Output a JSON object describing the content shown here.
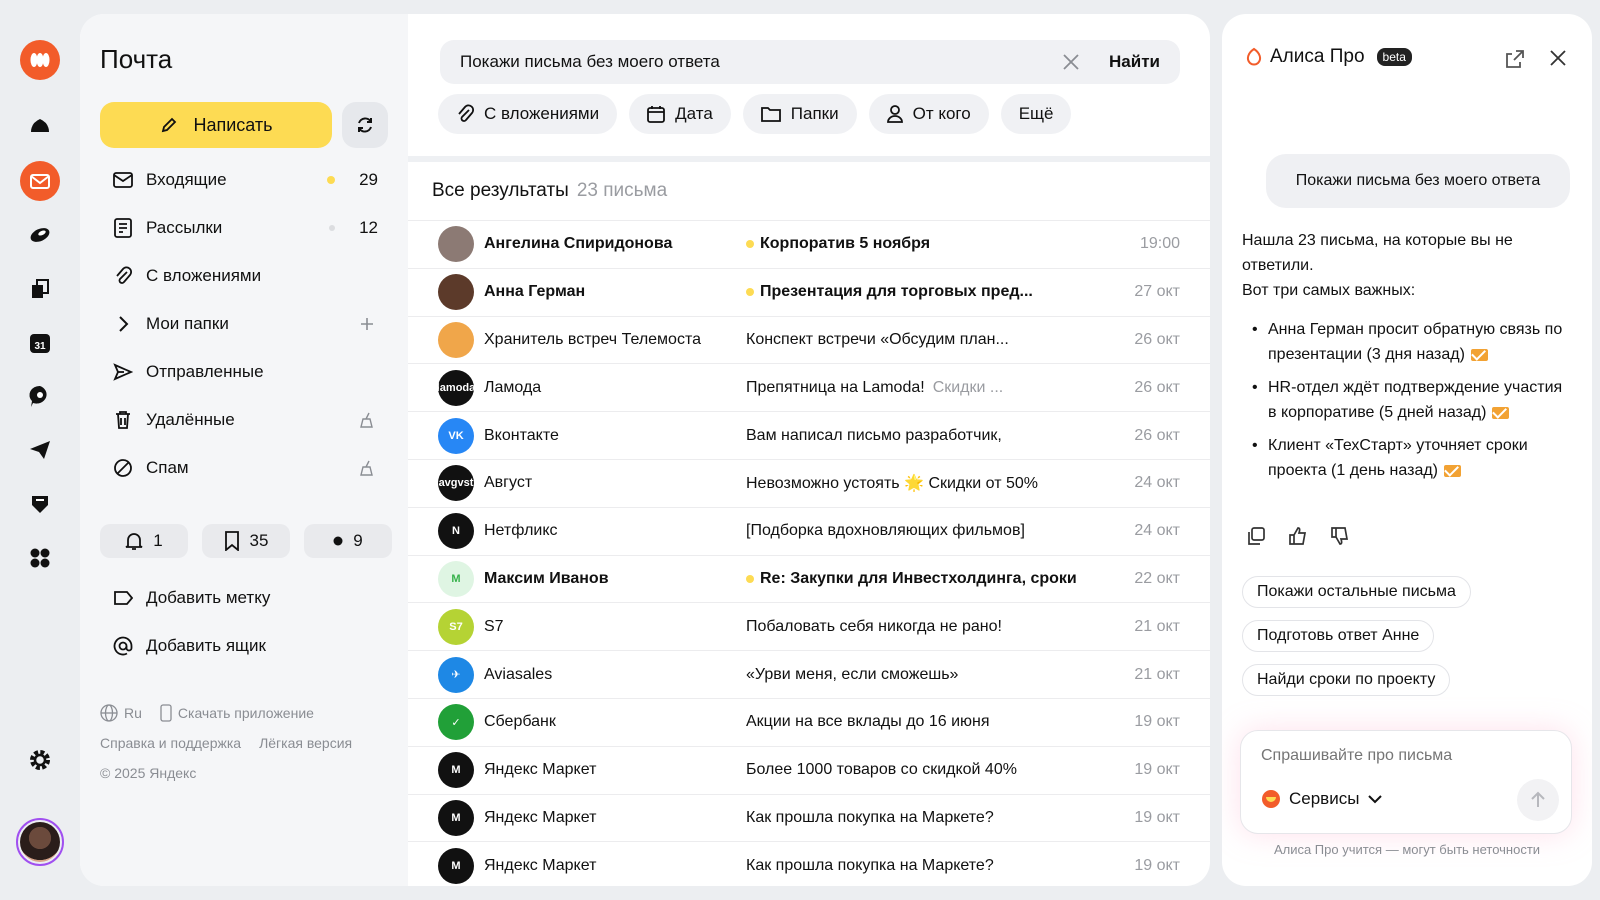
{
  "app": {
    "title": "Почта"
  },
  "compose": {
    "label": "Написать"
  },
  "folders": [
    {
      "label": "Входящие",
      "count": "29"
    },
    {
      "label": "Рассылки",
      "count": "12"
    },
    {
      "label": "С вложениями"
    },
    {
      "label": "Мои папки"
    },
    {
      "label": "Отправленные"
    },
    {
      "label": "Удалённые"
    },
    {
      "label": "Спам"
    }
  ],
  "counters": [
    {
      "value": "1"
    },
    {
      "value": "35"
    },
    {
      "value": "9"
    }
  ],
  "extra": [
    {
      "label": "Добавить метку"
    },
    {
      "label": "Добавить ящик"
    }
  ],
  "footer": {
    "lang": "Ru",
    "download": "Скачать приложение",
    "help": "Справка и поддержка",
    "lite": "Лёгкая версия",
    "copyright": "© 2025 Яндекс"
  },
  "search": {
    "value": "Покажи письма без моего ответа",
    "find_label": "Найти"
  },
  "filters": [
    "С вложениями",
    "Дата",
    "Папки",
    "От кого",
    "Ещё"
  ],
  "results": {
    "title": "Все результаты",
    "count": "23 письма"
  },
  "emails": [
    {
      "sender": "Ангелина Спиридонова",
      "subject": "Корпоратив 5 ноября",
      "snippet": "",
      "date": "19:00",
      "unread": true,
      "avatar_color": "#8c7a74",
      "avatar_text": ""
    },
    {
      "sender": "Анна Герман",
      "subject": "Презентация для торговых пред...",
      "snippet": "",
      "date": "27 окт",
      "unread": true,
      "avatar_color": "#5c3a2a",
      "avatar_text": ""
    },
    {
      "sender": "Хранитель встреч Телемоста",
      "subject": "Конспект встречи «Обсудим план...",
      "snippet": "",
      "date": "26 окт",
      "unread": false,
      "avatar_color": "#f0a64a",
      "avatar_text": ""
    },
    {
      "sender": "Ламода",
      "subject": "Препятница на Lamoda!",
      "snippet": "Скидки ...",
      "date": "26 окт",
      "unread": false,
      "avatar_color": "#111111",
      "avatar_text": "lamoda"
    },
    {
      "sender": "Вконтакте",
      "subject": "Вам написал письмо разработчик,",
      "snippet": "",
      "date": "26 окт",
      "unread": false,
      "avatar_color": "#2787f5",
      "avatar_text": "VK"
    },
    {
      "sender": "Август",
      "subject": "Невозможно устоять 🌟 Скидки от 50%",
      "snippet": "",
      "date": "24 окт",
      "unread": false,
      "avatar_color": "#111111",
      "avatar_text": "avgvst"
    },
    {
      "sender": "Нетфликс",
      "subject": "[Подборка вдохновляющих фильмов]",
      "snippet": "",
      "date": "24 окт",
      "unread": false,
      "avatar_color": "#111111",
      "avatar_text": "N"
    },
    {
      "sender": "Максим Иванов",
      "subject": "Re: Закупки для Инвестхолдинга, сроки",
      "snippet": "",
      "date": "22 окт",
      "unread": true,
      "avatar_color": "#dff5e3",
      "avatar_text": "M"
    },
    {
      "sender": "S7",
      "subject": "Побаловать себя никогда не рано!",
      "snippet": "",
      "date": "21 окт",
      "unread": false,
      "avatar_color": "#b5d334",
      "avatar_text": "S7"
    },
    {
      "sender": "Aviasales",
      "subject": "«Урви меня, если сможешь»",
      "snippet": "",
      "date": "21 окт",
      "unread": false,
      "avatar_color": "#1e88e5",
      "avatar_text": "✈"
    },
    {
      "sender": "Сбербанк",
      "subject": "Акции на все вклады до 16 июня",
      "snippet": "",
      "date": "19 окт",
      "unread": false,
      "avatar_color": "#21a038",
      "avatar_text": "✓"
    },
    {
      "sender": "Яндекс Маркет",
      "subject": "Более 1000 товаров со скидкой 40%",
      "snippet": "",
      "date": "19 окт",
      "unread": false,
      "avatar_color": "#111111",
      "avatar_text": "M"
    },
    {
      "sender": "Яндекс Маркет",
      "subject": "Как прошла покупка на Маркете?",
      "snippet": "",
      "date": "19 окт",
      "unread": false,
      "avatar_color": "#111111",
      "avatar_text": "M"
    },
    {
      "sender": "Яндекс Маркет",
      "subject": "Как прошла покупка на Маркете?",
      "snippet": "",
      "date": "19 окт",
      "unread": false,
      "avatar_color": "#111111",
      "avatar_text": "M"
    }
  ],
  "alice": {
    "title": "Алиса Про",
    "badge": "beta",
    "user_message": "Покажи письма без моего ответа",
    "answer_intro_1": "Нашла 23 письма, на которые вы не ответили.",
    "answer_intro_2": "Вот три самых важных:",
    "bullets": [
      "Анна Герман просит обратную связь по презентации (3 дня назад)",
      "HR-отдел ждёт подтверждение участия в корпоративе (5 дней назад)",
      "Клиент «ТехСтарт» уточняет сроки проекта (1 день назад)"
    ],
    "suggestions": [
      "Покажи остальные письма",
      "Подготовь ответ Анне",
      "Найди сроки по проекту"
    ],
    "input_placeholder": "Спрашивайте про письма",
    "services_label": "Сервисы",
    "disclaimer": "Алиса Про учится — могут быть неточности"
  },
  "colors": {
    "accent_yellow": "#fddb53",
    "brand_orange": "#f25c2a",
    "envelope_orange": "#f2a233"
  }
}
